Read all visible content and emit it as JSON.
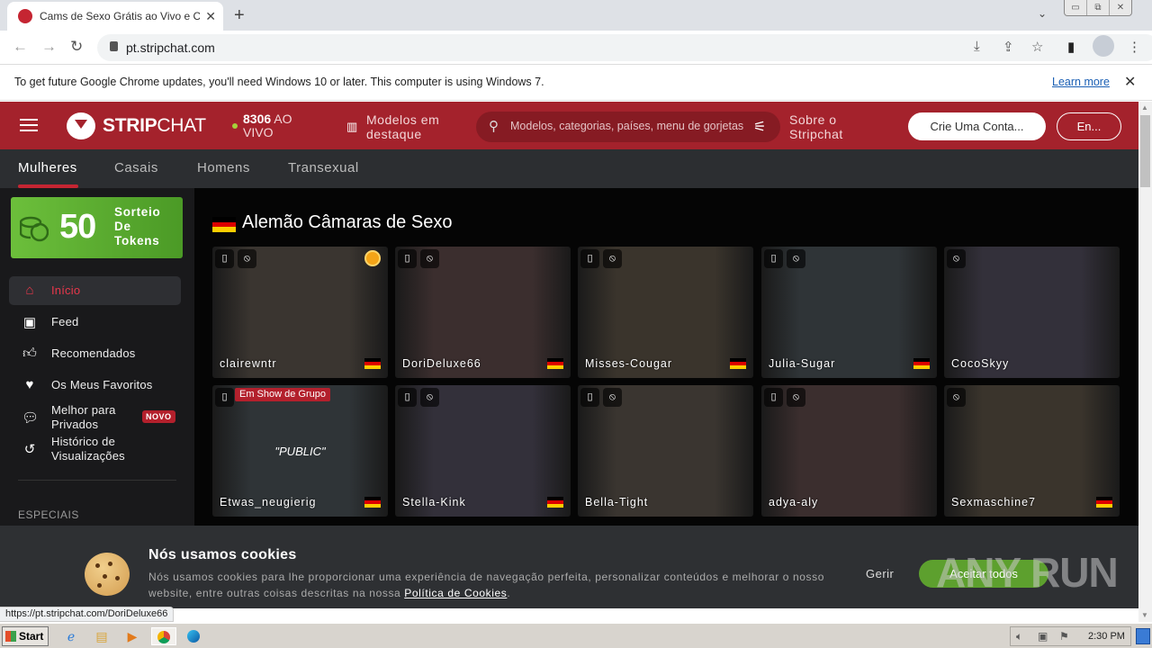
{
  "browser": {
    "tab_title": "Cams de Sexo Grátis ao Vivo e Chat",
    "url": "pt.stripchat.com",
    "window_buttons": [
      "minimize",
      "restore",
      "close"
    ],
    "toolbar_icons": [
      "install-icon",
      "share-icon",
      "bookmark-star-icon",
      "side-panel-icon",
      "profile-icon",
      "menu-icon"
    ]
  },
  "infobar": {
    "message": "To get future Google Chrome updates, you'll need Windows 10 or later. This computer is using Windows 7.",
    "link": "Learn more"
  },
  "header": {
    "logo_bold": "STRIP",
    "logo_light": "CHAT",
    "live_count": "8306",
    "live_label_1": "AO",
    "live_label_2": "VIVO",
    "featured": "Modelos em destaque",
    "search_placeholder": "Modelos, categorias, países, menu de gorjetas",
    "about": "Sobre o Stripchat",
    "signup": "Crie Uma Conta...",
    "login": "En..."
  },
  "subnav": {
    "tabs": [
      {
        "label": "Mulheres",
        "active": true
      },
      {
        "label": "Casais",
        "active": false
      },
      {
        "label": "Homens",
        "active": false
      },
      {
        "label": "Transexual",
        "active": false
      }
    ]
  },
  "sidebar": {
    "promo": {
      "number": "50",
      "label": "Sorteio De Tokens"
    },
    "items": [
      {
        "label": "Início",
        "icon": "home-icon",
        "active": true
      },
      {
        "label": "Feed",
        "icon": "feed-icon"
      },
      {
        "label": "Recomendados",
        "icon": "thumbs-up-icon"
      },
      {
        "label": "Os Meus Favoritos",
        "icon": "heart-icon"
      },
      {
        "label": "Melhor para Privados",
        "icon": "chat-bubbles-icon",
        "badge": "NOVO"
      },
      {
        "label": "Histórico de Visualizações",
        "icon": "history-icon"
      }
    ],
    "section_label": "ESPECIAIS"
  },
  "main": {
    "section_title": "Alemão Câmaras de Sexo",
    "flag_colors": [
      "#000000",
      "#dd0000",
      "#ffce00"
    ],
    "cards": [
      {
        "name": "clairewntr",
        "mobile": true,
        "interactive_toy": true,
        "medal": true,
        "flag": true
      },
      {
        "name": "DoriDeluxe66",
        "mobile": true,
        "interactive_toy": true,
        "flag": true
      },
      {
        "name": "Misses-Cougar",
        "mobile": true,
        "interactive_toy": true,
        "flag": true
      },
      {
        "name": "Julia-Sugar",
        "mobile": true,
        "interactive_toy": true,
        "flag": true
      },
      {
        "name": "CocoSkyy",
        "mobile": false,
        "interactive_toy": true,
        "flag": false
      },
      {
        "name": "Etwas_neugierig",
        "mobile": true,
        "interactive_toy": false,
        "group_show": "Em Show de Grupo",
        "overlay_text": "\"PUBLIC\"",
        "flag": true
      },
      {
        "name": "Stella-Kink",
        "mobile": true,
        "interactive_toy": true,
        "flag": true
      },
      {
        "name": "Bella-Tight",
        "mobile": true,
        "interactive_toy": true,
        "flag": false
      },
      {
        "name": "adya-aly",
        "mobile": true,
        "interactive_toy": true,
        "flag": false
      },
      {
        "name": "Sexmaschine7",
        "mobile": false,
        "interactive_toy": true,
        "flag": true
      }
    ]
  },
  "cookie_banner": {
    "title": "Nós usamos cookies",
    "body": "Nós usamos cookies para lhe proporcionar uma experiência de navegação perfeita, personalizar conteúdos e melhorar o nosso website, entre outras coisas descritas na nossa ",
    "policy_link": "Política de Cookies",
    "manage": "Gerir",
    "accept": "Aceitar todos"
  },
  "watermark": "ANY RUN",
  "status_url": "https://pt.stripchat.com/DoriDeluxe66",
  "taskbar": {
    "start": "Start",
    "apps": [
      "internet-explorer-icon",
      "file-explorer-icon",
      "media-player-icon",
      "chrome-icon",
      "edge-icon"
    ],
    "clock": "2:30 PM"
  },
  "colors": {
    "brand_red": "#a4222c",
    "accent_green": "#5da02e",
    "active_pink": "#e8374b"
  }
}
